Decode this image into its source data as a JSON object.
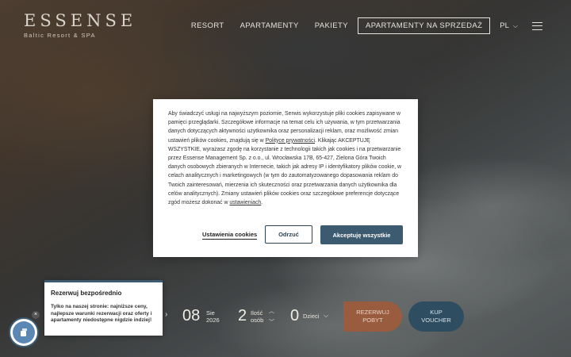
{
  "brand": {
    "logo_word": "ESSENSE",
    "logo_sub": "Baltic Resort & SPA"
  },
  "nav": {
    "items": [
      "RESORT",
      "APARTAMENTY",
      "PAKIETY"
    ],
    "highlight": "APARTAMENTY NA SPRZEDAŻ",
    "lang": "PL",
    "lang_chevron": "⌵",
    "menu_icon": "hamburger-icon"
  },
  "cookie": {
    "text_1": "Aby świadczyć usługi na najwyższym poziomie, Serwis wykorzystuje pliki cookies zapisywane w pamięci przeglądarki. Szczegółowe informacje na temat celu ich używania, w tym przetwarzania danych dotyczących aktywności użytkownika oraz personalizacji reklam, oraz możliwość zmian ustawień plików cookies, znajdują się w",
    "link_policy": "Polityce prywatności",
    "text_2": ". Klikając AKCEPTUJĘ WSZYSTKIE, wyrażasz zgodę na korzystanie z technologii takich jak cookies i na przetwarzanie przez Essense Management Sp. z o.o., ul. Wrocławska 17B, 65-427, Zielona Góra Twoich danych osobowych zbieranych w Internecie, takich jak adresy IP i identyfikatory plików cookie, w celach analitycznych i marketingowych (w tym do zautomatyzowanego dopasowania reklam do Twoich zainteresowań, mierzenia ich skuteczności oraz przetwarzania danych użytkownika dla celów analitycznych). Zmiany ustawień plików cookies oraz szczegółowe preferencje dotyczące zgód możesz dokonać w",
    "link_settings": "ustawieniach",
    "text_3": ".",
    "btn_settings": "Ustawienia cookies",
    "btn_decline": "Odrzuć",
    "btn_accept": "Akceptuję wszystkie"
  },
  "booking": {
    "prev_arrow": "›",
    "day": "08",
    "month": "Sie",
    "year": "2026",
    "qty": "2",
    "qty_label_1": "Ilość",
    "qty_label_2": "osób",
    "qty_up": "︿",
    "qty_down": "﹀",
    "kids": "0",
    "kids_label": "Dzieci",
    "kids_chevron": "⌵",
    "reserve_1": "REZERWUJ",
    "reserve_2": "POBYT",
    "buy_1": "KUP",
    "buy_2": "VOUCHER"
  },
  "promo": {
    "title": "Rezerwuj bezpośrednio",
    "body": "Tylko na naszej stronie: najniższe ceny, najlepsze warunki rezerwacji oraz oferty i apartamenty niedostępne nigdzie indziej!",
    "close": "×",
    "avatar_icon": "concierge-icon"
  }
}
